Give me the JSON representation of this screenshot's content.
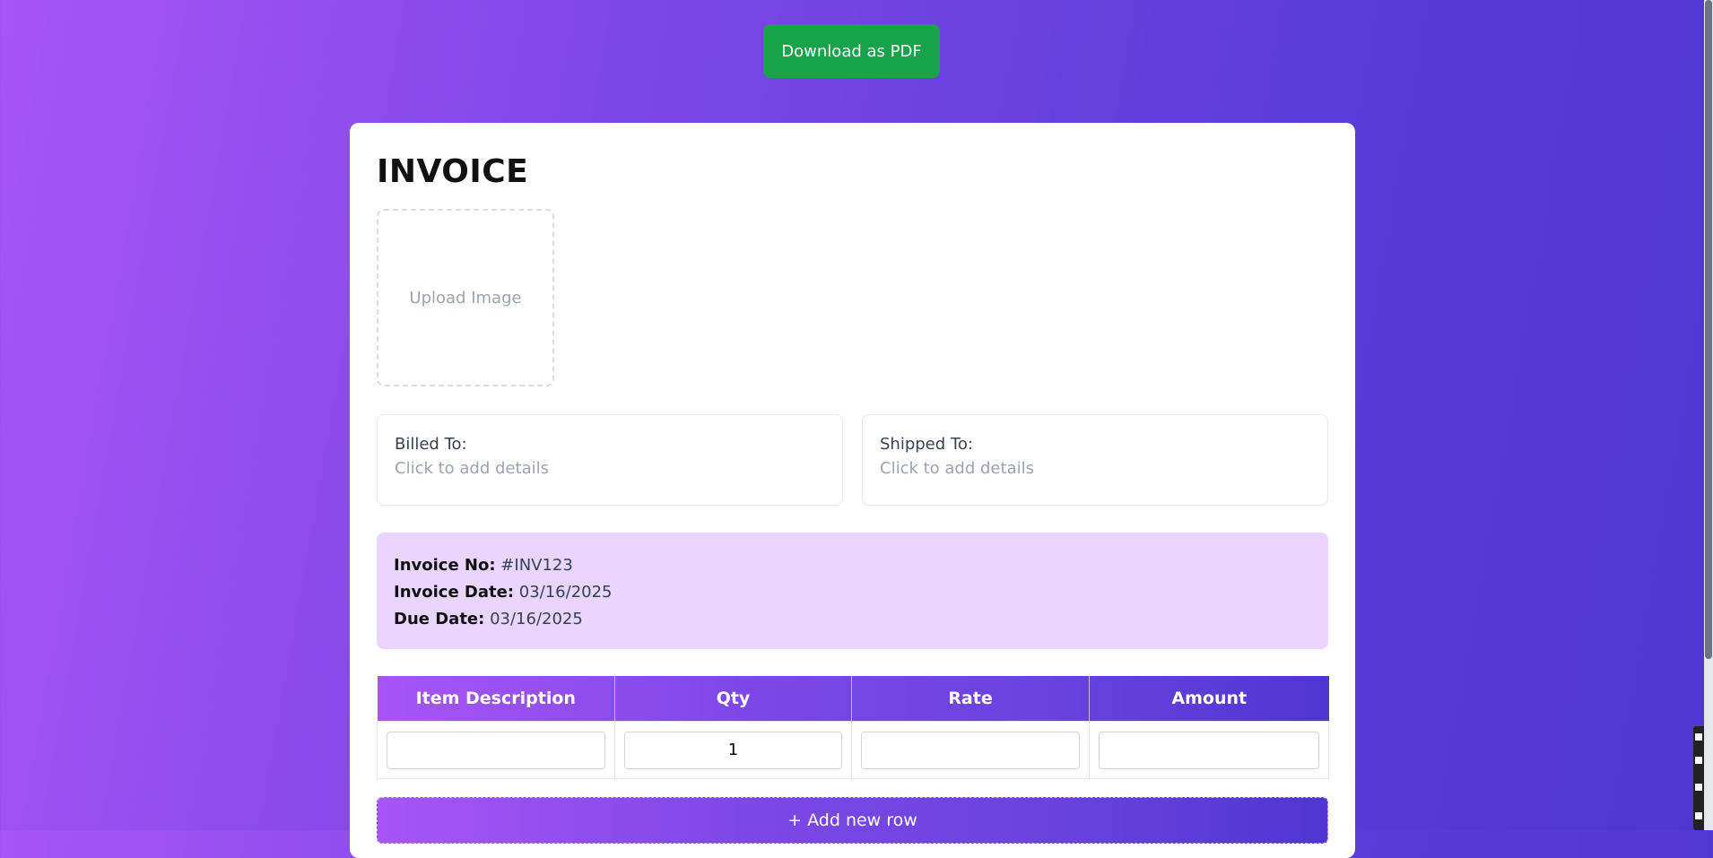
{
  "toolbar": {
    "download_label": "Download as PDF"
  },
  "invoice": {
    "title": "INVOICE",
    "upload_label": "Upload Image",
    "billed_to": {
      "label": "Billed To:",
      "placeholder": "Click to add details"
    },
    "shipped_to": {
      "label": "Shipped To:",
      "placeholder": "Click to add details"
    },
    "meta": {
      "number_label": "Invoice No:",
      "number_value": "#INV123",
      "date_label": "Invoice Date:",
      "date_value": "03/16/2025",
      "due_label": "Due Date:",
      "due_value": "03/16/2025"
    },
    "table": {
      "headers": [
        "Item Description",
        "Qty",
        "Rate",
        "Amount"
      ],
      "rows": [
        {
          "description": "",
          "qty": "1",
          "rate": "",
          "amount": ""
        }
      ]
    },
    "add_row_label": "+ Add new row"
  },
  "colors": {
    "accent_green": "#16a34a",
    "gradient_start": "#a855f7",
    "gradient_end": "#4f36d1",
    "meta_background": "#e9d5ff"
  },
  "icons": [
    "scrollbar",
    "floating-toolbar"
  ]
}
